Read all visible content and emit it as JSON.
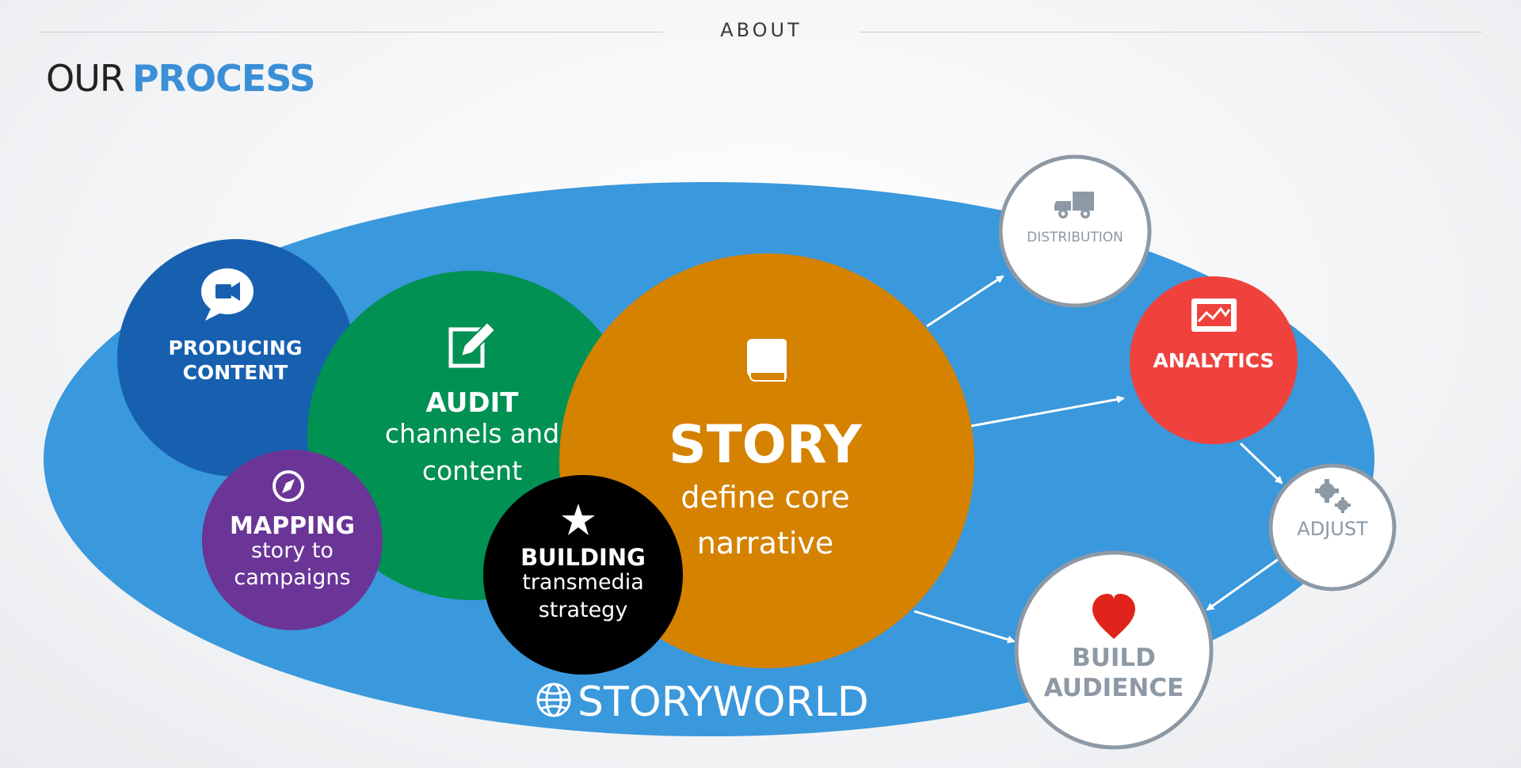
{
  "header": {
    "section_label": "ABOUT",
    "title_part1": "OUR",
    "title_part2": "PROCESS"
  },
  "diagram": {
    "storyworld_label": "STORYWORLD",
    "producing": {
      "line1": "PRODUCING",
      "line2": "CONTENT",
      "icon": "video-chat-icon"
    },
    "audit": {
      "title": "AUDIT",
      "line1": "channels and",
      "line2": "content",
      "icon": "edit-icon"
    },
    "mapping": {
      "title": "MAPPING",
      "line1": "story to",
      "line2": "campaigns",
      "icon": "compass-icon"
    },
    "building": {
      "title": "BUILDING",
      "line1": "transmedia",
      "line2": "strategy",
      "icon": "star-icon"
    },
    "story": {
      "title": "STORY",
      "line1": "define core",
      "line2": "narrative",
      "icon": "book-icon"
    },
    "distribution": {
      "label": "DISTRIBUTION",
      "icon": "truck-icon"
    },
    "analytics": {
      "label": "ANALYTICS",
      "icon": "chart-icon"
    },
    "adjust": {
      "label": "ADJUST",
      "icon": "gears-icon"
    },
    "build_audience": {
      "line1": "BUILD",
      "line2": "AUDIENCE",
      "icon": "heart-icon"
    }
  },
  "colors": {
    "ellipse": "#3a98dc",
    "producing": "#1760b0",
    "audit": "#019153",
    "mapping": "#6a3597",
    "building": "#000000",
    "story": "#d48200",
    "analytics": "#ef423d",
    "outline_circle": "#8d99a5",
    "heart": "#e0241b",
    "accent": "#3a8fd6"
  }
}
